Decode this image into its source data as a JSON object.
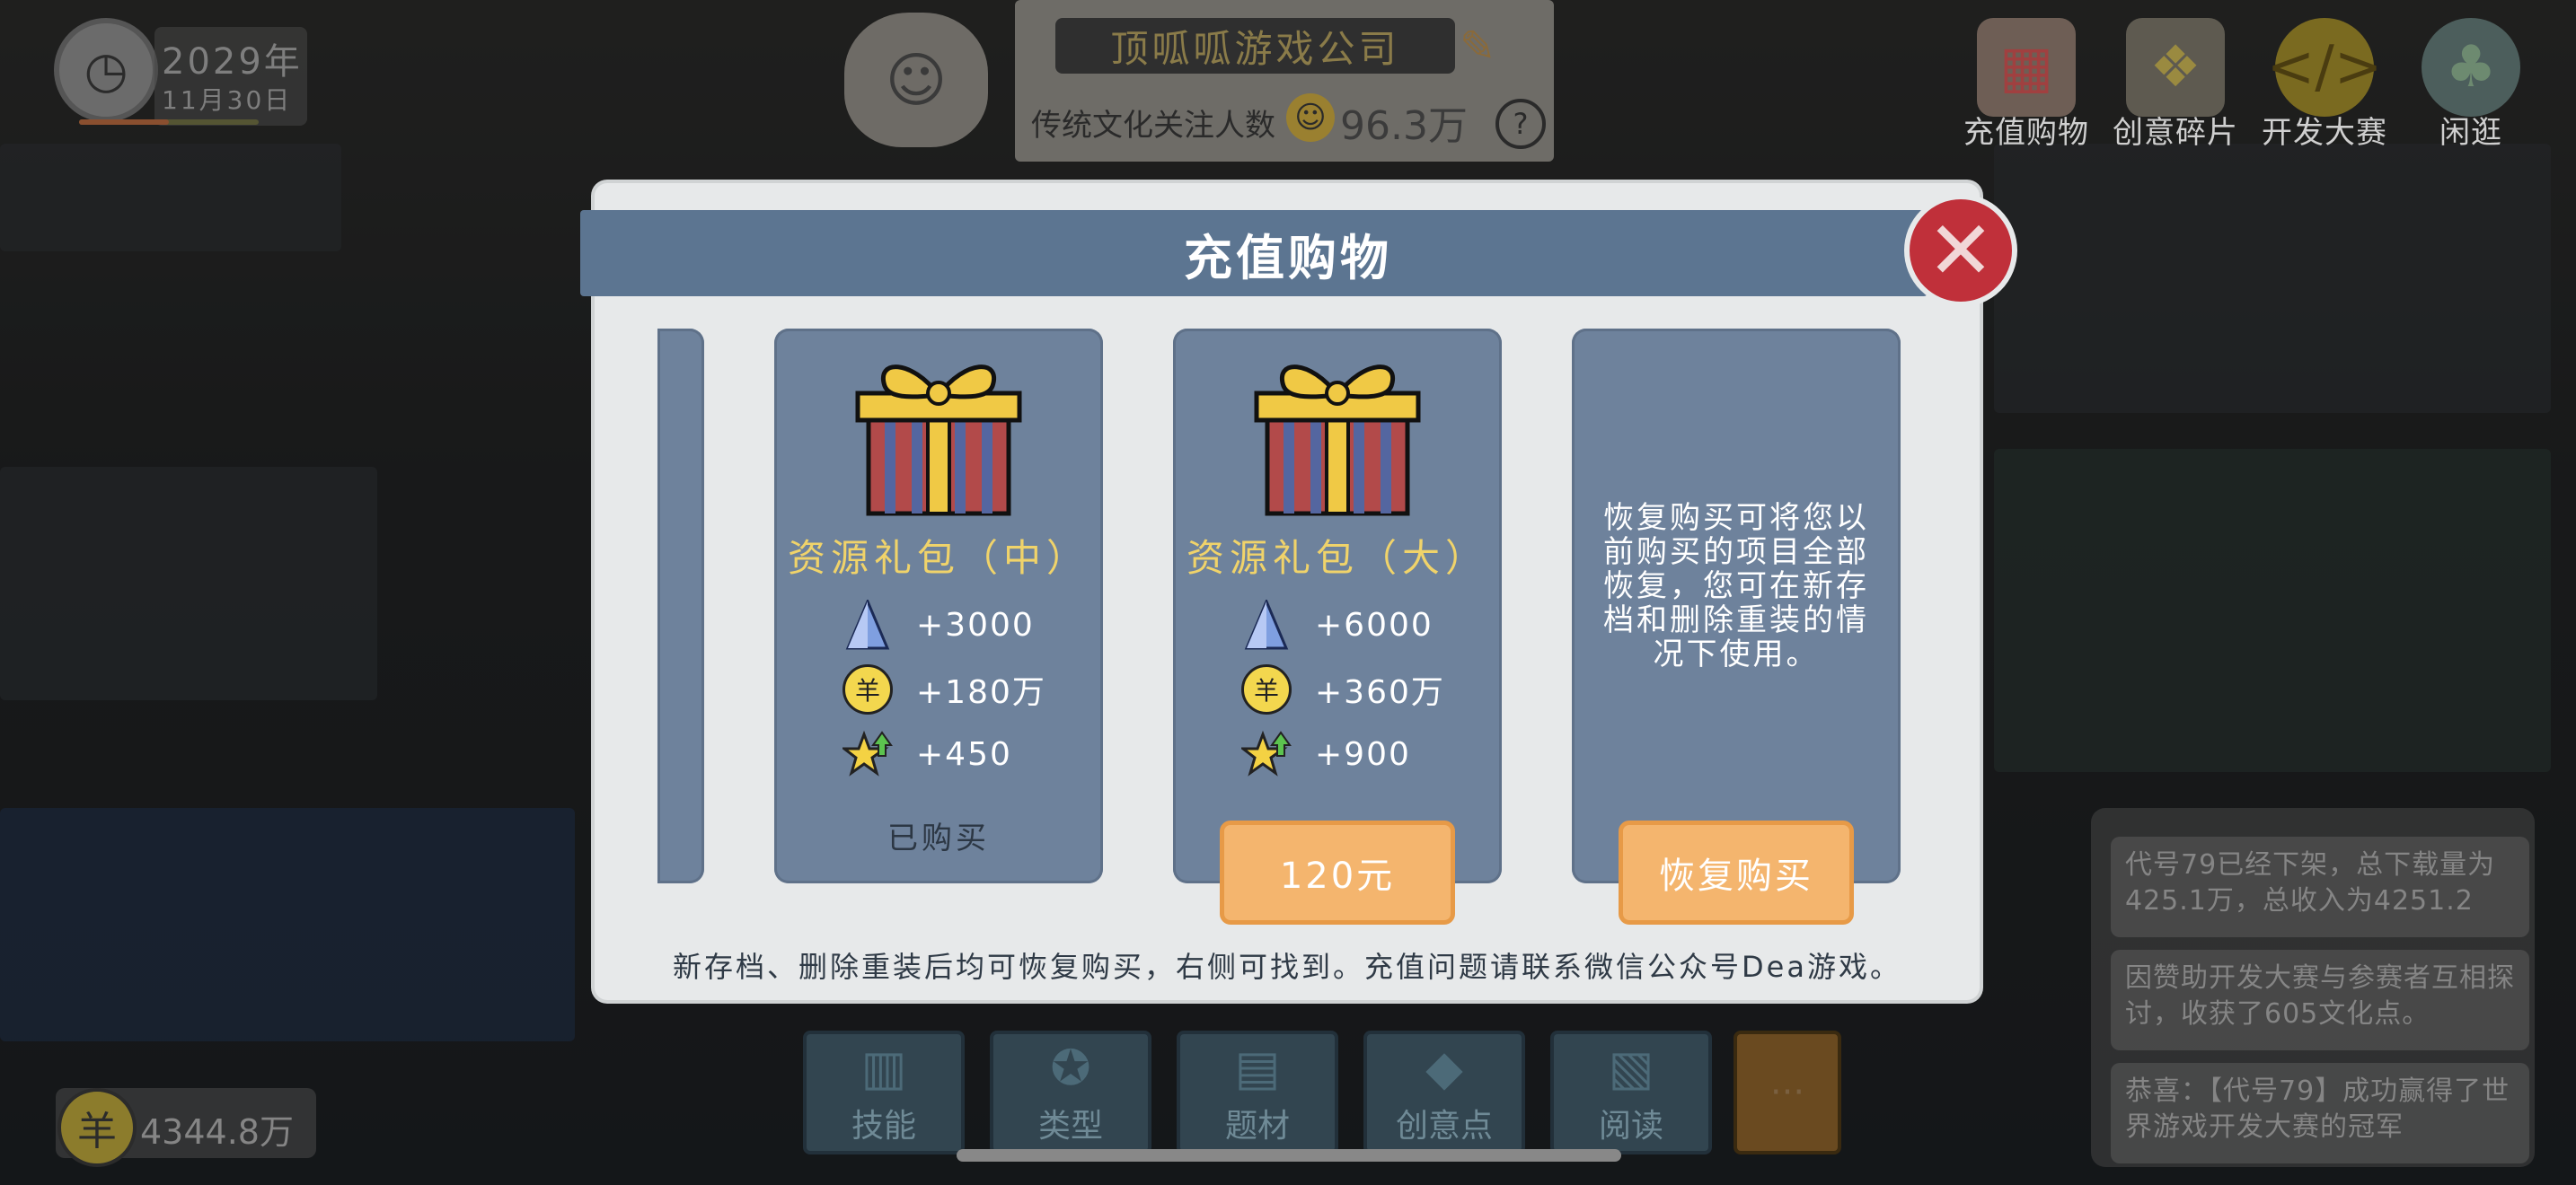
{
  "hud": {
    "year": "2029年",
    "date": "11月30日",
    "company_name": "顶呱呱游戏公司",
    "fans_label": "传统文化关注人数",
    "fans_value": "96.3万",
    "money": "4344.8万",
    "progress": 0.5
  },
  "top_menu": [
    {
      "label": "充值购物",
      "icon": "shop-icon"
    },
    {
      "label": "创意碎片",
      "icon": "gift-icon"
    },
    {
      "label": "开发大赛",
      "icon": "code-trophy-icon"
    },
    {
      "label": "闲逛",
      "icon": "tree-bench-icon"
    }
  ],
  "bottom_nav": [
    {
      "label": "技能",
      "icon": "book-icon"
    },
    {
      "label": "类型",
      "icon": "gamepad-icon"
    },
    {
      "label": "题材",
      "icon": "notebook-icon"
    },
    {
      "label": "创意点",
      "icon": "diamond-icon"
    },
    {
      "label": "阅读",
      "icon": "open-book-icon"
    }
  ],
  "more_label": "···",
  "notifications": [
    "代号79已经下架，总下载量为425.1万，总收入为4251.2",
    "因赞助开发大赛与参赛者互相探讨，收获了605文化点。",
    "恭喜：【代号79】成功赢得了世界游戏开发大赛的冠军"
  ],
  "modal": {
    "title": "充值购物",
    "cards": [
      {
        "title": "资源礼包（中）",
        "rows": [
          {
            "icon": "crystal-icon",
            "value": "+3000"
          },
          {
            "icon": "coin-icon",
            "value": "+180万"
          },
          {
            "icon": "star-up-icon",
            "value": "+450"
          }
        ],
        "status": "已购买"
      },
      {
        "title": "资源礼包（大）",
        "rows": [
          {
            "icon": "crystal-icon",
            "value": "+6000"
          },
          {
            "icon": "coin-icon",
            "value": "+360万"
          },
          {
            "icon": "star-up-icon",
            "value": "+900"
          }
        ],
        "button": "120元"
      },
      {
        "description": "恢复购买可将您以前购买的项目全部恢复，您可在新存档和删除重装的情况下使用。",
        "button": "恢复购买"
      }
    ],
    "footer": "新存档、删除重装后均可恢复购买，右侧可找到。充值问题请联系微信公众号Dea游戏。"
  },
  "colors": {
    "modal_bg": "#e7e9ea",
    "title_bar": "#5c7591",
    "card": "#6e829c",
    "card_title": "#f0d36a",
    "button": "#f4b56e",
    "close": "#c0303a"
  },
  "coin_glyph": "羊"
}
